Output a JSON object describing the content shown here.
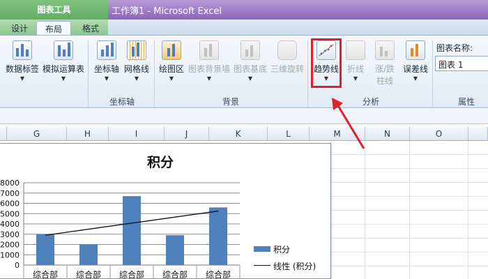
{
  "window": {
    "context_group": "图表工具",
    "title": "工作簿1  -  Microsoft Excel"
  },
  "tabs": [
    {
      "label": "设计",
      "active": false
    },
    {
      "label": "布局",
      "active": true
    },
    {
      "label": "格式",
      "active": false
    }
  ],
  "ribbon": {
    "groups": {
      "axes": "坐标轴",
      "background": "背景",
      "analysis": "分析",
      "properties": "属性"
    },
    "buttons": {
      "data_labels": "数据标签",
      "data_table": "模拟运算表",
      "axes": "坐标轴",
      "gridlines": "网格线",
      "plot_area": "绘图区",
      "chart_wall": "图表背景墙",
      "chart_floor": "图表基底",
      "rotation_3d": "三维旋转",
      "trendline": "趋势线",
      "lines": "折线",
      "updown_bars_1": "涨/跌",
      "updown_bars_2": "柱线",
      "error_bars": "误差线"
    },
    "chart_name_label": "图表名称:",
    "chart_name_value": "图表 1"
  },
  "columns": [
    "G",
    "H",
    "I",
    "J",
    "K",
    "L",
    "M",
    "N",
    "O"
  ],
  "colors": {
    "bar": "#4f81bd",
    "highlight": "#e0202a",
    "ribbon_accent": "#8c64b8"
  },
  "chart_data": {
    "type": "bar",
    "title": "积分",
    "categories": [
      "综合部",
      "综合部",
      "综合部",
      "综合部",
      "综合部"
    ],
    "series": [
      {
        "name": "积分",
        "values": [
          3000,
          2000,
          6700,
          2900,
          5600
        ]
      }
    ],
    "trendline": {
      "name": "线性 (积分)",
      "start": 2900,
      "end": 5250
    },
    "y_ticks": [
      "0",
      "1000",
      "2000",
      "3000",
      "4000",
      "5000",
      "6000",
      "7000",
      "8000"
    ],
    "ylim": [
      0,
      8000
    ],
    "grid": true,
    "legend_position": "right"
  }
}
